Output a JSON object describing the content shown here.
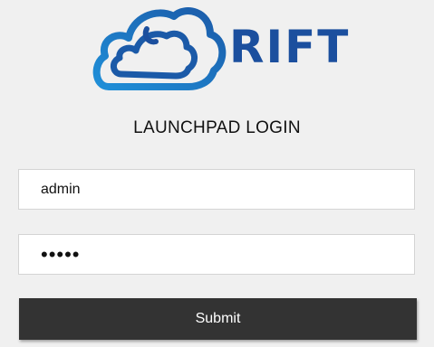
{
  "logo": {
    "brand_text": "RIFT",
    "icon_name": "cloud-icon",
    "color_dark": "#1b4f9e",
    "color_light": "#1f8fd8"
  },
  "login": {
    "title": "LAUNCHPAD LOGIN",
    "username_value": "admin",
    "password_mask": "•••••",
    "submit_label": "Submit"
  }
}
